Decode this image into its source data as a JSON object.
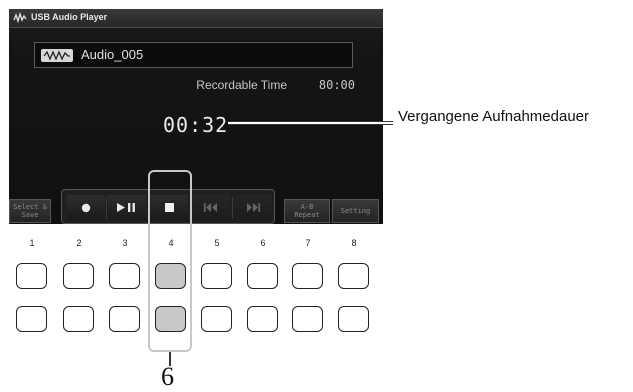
{
  "window": {
    "title": "USB Audio Player",
    "icon": "usb-audio-icon"
  },
  "player": {
    "file_icon": "audio-waveform-icon",
    "file_name": "Audio_005",
    "recordable_label": "Recordable Time",
    "recordable_time": "80:00",
    "elapsed_time": "00:32"
  },
  "controls": {
    "select_save": "Select &\nSave",
    "record": "record-icon",
    "play_pause": "play-pause-icon",
    "stop": "stop-icon",
    "rewind": "rewind-icon",
    "fast_forward": "fast-forward-icon",
    "ab_repeat": "A-B\nRepeat",
    "setting": "Setting"
  },
  "panel": {
    "button_numbers": [
      "1",
      "2",
      "3",
      "4",
      "5",
      "6",
      "7",
      "8"
    ],
    "active_column": "4"
  },
  "annotations": {
    "elapsed_label": "Vergangene Aufnahmedauer",
    "step_number": "6"
  },
  "colors": {
    "screen_bg": "#151515",
    "active_button": "#c8c8c8",
    "highlight_frame": "#c8c8c8"
  }
}
